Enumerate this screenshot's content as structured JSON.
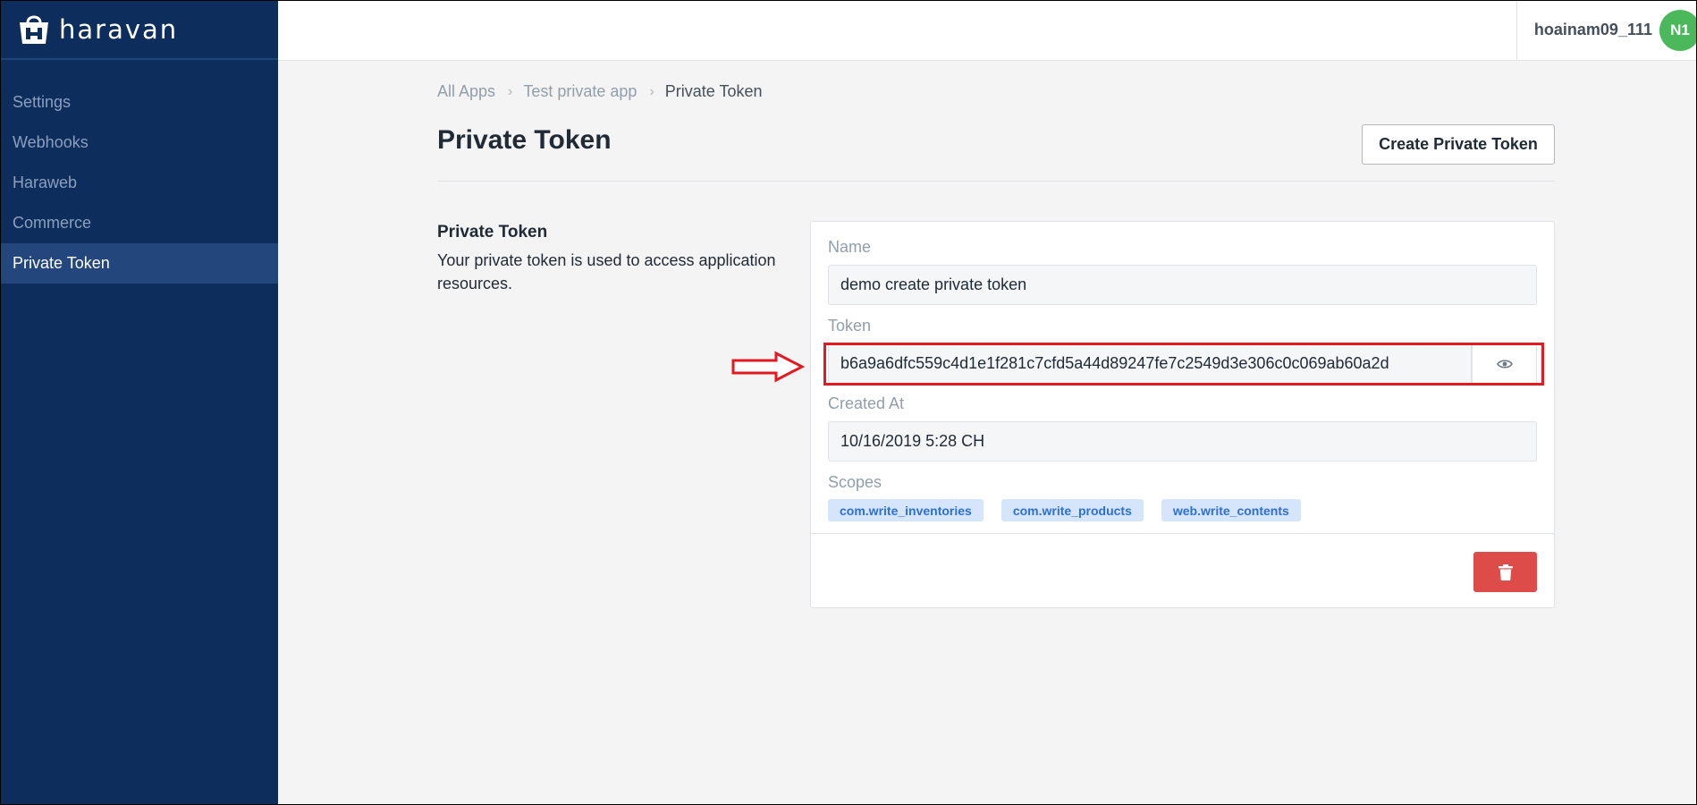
{
  "brand": {
    "name": "haravan"
  },
  "sidebar": {
    "items": [
      {
        "label": "Settings",
        "active": false
      },
      {
        "label": "Webhooks",
        "active": false
      },
      {
        "label": "Haraweb",
        "active": false
      },
      {
        "label": "Commerce",
        "active": false
      },
      {
        "label": "Private Token",
        "active": true
      }
    ]
  },
  "user": {
    "name": "hoainam09_111",
    "initials": "N1",
    "avatar_color": "#4cb85c"
  },
  "breadcrumb": [
    "All Apps",
    "Test private app",
    "Private Token"
  ],
  "page": {
    "title": "Private Token",
    "create_button": "Create Private Token",
    "section_title": "Private Token",
    "section_description": "Your private token is used to access application resources."
  },
  "token_card": {
    "name_label": "Name",
    "name_value": "demo create private token",
    "token_label": "Token",
    "token_value": "b6a9a6dfc559c4d1e1f281c7cfd5a44d89247fe7c2549d3e306c0c069ab60a2d",
    "created_label": "Created At",
    "created_value": "10/16/2019 5:28 CH",
    "scopes_label": "Scopes",
    "scopes": [
      "com.write_inventories",
      "com.write_products",
      "web.write_contents"
    ]
  },
  "colors": {
    "sidebar_bg": "#0d2d5c",
    "sidebar_active": "#23477c",
    "annotation_red": "#e21b23",
    "delete_red": "#de4c4a",
    "scope_tag_bg": "#d5e5fb",
    "scope_tag_text": "#2e6fd6"
  }
}
